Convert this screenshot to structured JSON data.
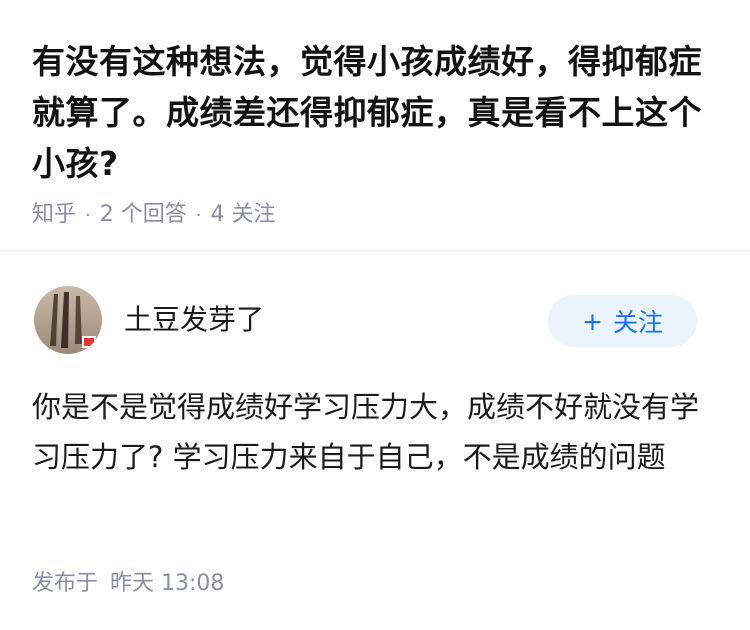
{
  "question": {
    "title": "有没有这种想法，觉得小孩成绩好，得抑郁症就算了。成绩差还得抑郁症，真是看不上这个小孩?",
    "source": "知乎",
    "separator": "·",
    "answers_count": "2 个回答",
    "followers_count": "4 关注"
  },
  "answer": {
    "author_name": "土豆发芽了",
    "follow_icon": "+",
    "follow_label": "关注",
    "content": "你是不是觉得成绩好学习压力大，成绩不好就没有学习压力了? 学习压力来自于自己，不是成绩的问题",
    "published_label": "发布于",
    "published_time": "昨天 13:08"
  },
  "colors": {
    "meta_gray": "#8590a6",
    "accent_blue": "#1772f6",
    "follow_bg": "#ebf3fc",
    "divider": "#ebebeb"
  }
}
